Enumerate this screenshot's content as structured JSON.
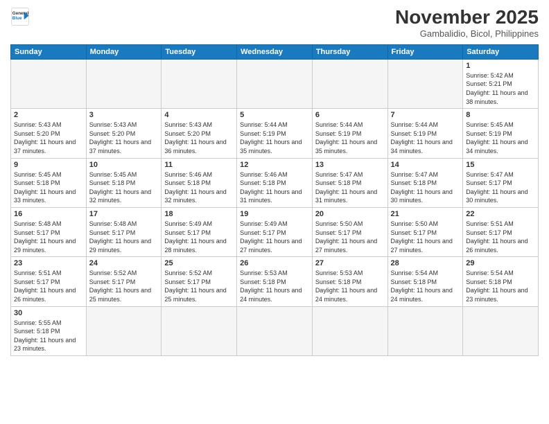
{
  "logo": {
    "line1": "General",
    "line2": "Blue"
  },
  "title": "November 2025",
  "subtitle": "Gambalidio, Bicol, Philippines",
  "days_of_week": [
    "Sunday",
    "Monday",
    "Tuesday",
    "Wednesday",
    "Thursday",
    "Friday",
    "Saturday"
  ],
  "weeks": [
    [
      {
        "day": "",
        "empty": true
      },
      {
        "day": "",
        "empty": true
      },
      {
        "day": "",
        "empty": true
      },
      {
        "day": "",
        "empty": true
      },
      {
        "day": "",
        "empty": true
      },
      {
        "day": "",
        "empty": true
      },
      {
        "day": "1",
        "sunrise": "Sunrise: 5:42 AM",
        "sunset": "Sunset: 5:21 PM",
        "daylight": "Daylight: 11 hours and 38 minutes."
      }
    ],
    [
      {
        "day": "2",
        "sunrise": "Sunrise: 5:43 AM",
        "sunset": "Sunset: 5:20 PM",
        "daylight": "Daylight: 11 hours and 37 minutes."
      },
      {
        "day": "3",
        "sunrise": "Sunrise: 5:43 AM",
        "sunset": "Sunset: 5:20 PM",
        "daylight": "Daylight: 11 hours and 37 minutes."
      },
      {
        "day": "4",
        "sunrise": "Sunrise: 5:43 AM",
        "sunset": "Sunset: 5:20 PM",
        "daylight": "Daylight: 11 hours and 36 minutes."
      },
      {
        "day": "5",
        "sunrise": "Sunrise: 5:44 AM",
        "sunset": "Sunset: 5:19 PM",
        "daylight": "Daylight: 11 hours and 35 minutes."
      },
      {
        "day": "6",
        "sunrise": "Sunrise: 5:44 AM",
        "sunset": "Sunset: 5:19 PM",
        "daylight": "Daylight: 11 hours and 35 minutes."
      },
      {
        "day": "7",
        "sunrise": "Sunrise: 5:44 AM",
        "sunset": "Sunset: 5:19 PM",
        "daylight": "Daylight: 11 hours and 34 minutes."
      },
      {
        "day": "8",
        "sunrise": "Sunrise: 5:45 AM",
        "sunset": "Sunset: 5:19 PM",
        "daylight": "Daylight: 11 hours and 34 minutes."
      }
    ],
    [
      {
        "day": "9",
        "sunrise": "Sunrise: 5:45 AM",
        "sunset": "Sunset: 5:18 PM",
        "daylight": "Daylight: 11 hours and 33 minutes."
      },
      {
        "day": "10",
        "sunrise": "Sunrise: 5:45 AM",
        "sunset": "Sunset: 5:18 PM",
        "daylight": "Daylight: 11 hours and 32 minutes."
      },
      {
        "day": "11",
        "sunrise": "Sunrise: 5:46 AM",
        "sunset": "Sunset: 5:18 PM",
        "daylight": "Daylight: 11 hours and 32 minutes."
      },
      {
        "day": "12",
        "sunrise": "Sunrise: 5:46 AM",
        "sunset": "Sunset: 5:18 PM",
        "daylight": "Daylight: 11 hours and 31 minutes."
      },
      {
        "day": "13",
        "sunrise": "Sunrise: 5:47 AM",
        "sunset": "Sunset: 5:18 PM",
        "daylight": "Daylight: 11 hours and 31 minutes."
      },
      {
        "day": "14",
        "sunrise": "Sunrise: 5:47 AM",
        "sunset": "Sunset: 5:18 PM",
        "daylight": "Daylight: 11 hours and 30 minutes."
      },
      {
        "day": "15",
        "sunrise": "Sunrise: 5:47 AM",
        "sunset": "Sunset: 5:17 PM",
        "daylight": "Daylight: 11 hours and 30 minutes."
      }
    ],
    [
      {
        "day": "16",
        "sunrise": "Sunrise: 5:48 AM",
        "sunset": "Sunset: 5:17 PM",
        "daylight": "Daylight: 11 hours and 29 minutes."
      },
      {
        "day": "17",
        "sunrise": "Sunrise: 5:48 AM",
        "sunset": "Sunset: 5:17 PM",
        "daylight": "Daylight: 11 hours and 29 minutes."
      },
      {
        "day": "18",
        "sunrise": "Sunrise: 5:49 AM",
        "sunset": "Sunset: 5:17 PM",
        "daylight": "Daylight: 11 hours and 28 minutes."
      },
      {
        "day": "19",
        "sunrise": "Sunrise: 5:49 AM",
        "sunset": "Sunset: 5:17 PM",
        "daylight": "Daylight: 11 hours and 27 minutes."
      },
      {
        "day": "20",
        "sunrise": "Sunrise: 5:50 AM",
        "sunset": "Sunset: 5:17 PM",
        "daylight": "Daylight: 11 hours and 27 minutes."
      },
      {
        "day": "21",
        "sunrise": "Sunrise: 5:50 AM",
        "sunset": "Sunset: 5:17 PM",
        "daylight": "Daylight: 11 hours and 27 minutes."
      },
      {
        "day": "22",
        "sunrise": "Sunrise: 5:51 AM",
        "sunset": "Sunset: 5:17 PM",
        "daylight": "Daylight: 11 hours and 26 minutes."
      }
    ],
    [
      {
        "day": "23",
        "sunrise": "Sunrise: 5:51 AM",
        "sunset": "Sunset: 5:17 PM",
        "daylight": "Daylight: 11 hours and 26 minutes."
      },
      {
        "day": "24",
        "sunrise": "Sunrise: 5:52 AM",
        "sunset": "Sunset: 5:17 PM",
        "daylight": "Daylight: 11 hours and 25 minutes."
      },
      {
        "day": "25",
        "sunrise": "Sunrise: 5:52 AM",
        "sunset": "Sunset: 5:17 PM",
        "daylight": "Daylight: 11 hours and 25 minutes."
      },
      {
        "day": "26",
        "sunrise": "Sunrise: 5:53 AM",
        "sunset": "Sunset: 5:18 PM",
        "daylight": "Daylight: 11 hours and 24 minutes."
      },
      {
        "day": "27",
        "sunrise": "Sunrise: 5:53 AM",
        "sunset": "Sunset: 5:18 PM",
        "daylight": "Daylight: 11 hours and 24 minutes."
      },
      {
        "day": "28",
        "sunrise": "Sunrise: 5:54 AM",
        "sunset": "Sunset: 5:18 PM",
        "daylight": "Daylight: 11 hours and 24 minutes."
      },
      {
        "day": "29",
        "sunrise": "Sunrise: 5:54 AM",
        "sunset": "Sunset: 5:18 PM",
        "daylight": "Daylight: 11 hours and 23 minutes."
      }
    ],
    [
      {
        "day": "30",
        "sunrise": "Sunrise: 5:55 AM",
        "sunset": "Sunset: 5:18 PM",
        "daylight": "Daylight: 11 hours and 23 minutes."
      },
      {
        "day": "",
        "empty": true
      },
      {
        "day": "",
        "empty": true
      },
      {
        "day": "",
        "empty": true
      },
      {
        "day": "",
        "empty": true
      },
      {
        "day": "",
        "empty": true
      },
      {
        "day": "",
        "empty": true
      }
    ]
  ]
}
